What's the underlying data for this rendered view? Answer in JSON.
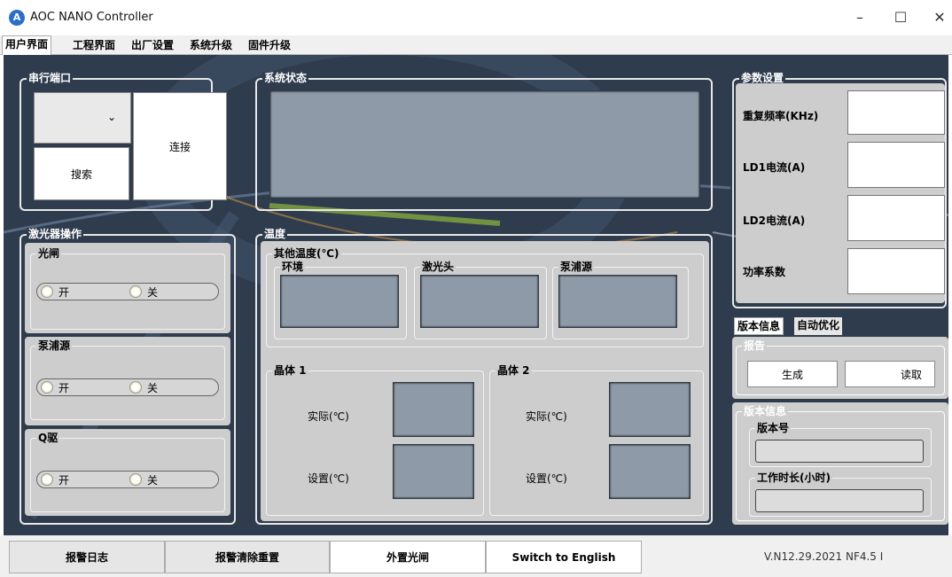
{
  "window": {
    "title": "AOC NANO Controller",
    "minimize": "–",
    "maximize": "☐",
    "close": "✕"
  },
  "tabs": [
    "用户界面",
    "工程界面",
    "出厂设置",
    "系统升级",
    "固件升级"
  ],
  "serial": {
    "title": "串行端口",
    "dropdown_arrow": "⌄",
    "search": "搜索",
    "connect": "连接"
  },
  "status": {
    "title": "系统状态"
  },
  "params": {
    "title": "参数设置",
    "rows": [
      "重复频率(KHz)",
      "LD1电流(A)",
      "LD2电流(A)",
      "功率系数"
    ]
  },
  "laser": {
    "title": "激光器操作",
    "groups": [
      {
        "name": "光闸",
        "on": "开",
        "off": "关"
      },
      {
        "name": "泵浦源",
        "on": "开",
        "off": "关"
      },
      {
        "name": "Q驱",
        "on": "开",
        "off": "关"
      }
    ]
  },
  "temperature": {
    "title": "温度",
    "other": {
      "title": "其他温度(℃)",
      "items": [
        "环境",
        "激光头",
        "泵浦源"
      ]
    },
    "crystal1": {
      "title": "晶体 1",
      "actual": "实际(℃)",
      "setting": "设置(℃)"
    },
    "crystal2": {
      "title": "晶体 2",
      "actual": "实际(℃)",
      "setting": "设置(℃)"
    }
  },
  "side_tabs": [
    "版本信息",
    "自动优化"
  ],
  "report": {
    "title": "报告",
    "generate": "生成",
    "read": "读取"
  },
  "version_info": {
    "title": "版本信息",
    "version_label": "版本号",
    "hours_label": "工作时长(小时)"
  },
  "bottom": {
    "alarm_log": "报警日志",
    "alarm_reset": "报警清除重置",
    "external_shutter": "外置光闸",
    "switch_lang": "Switch to English",
    "version": "V.N12.29.2021 NF4.5 I"
  },
  "colors": {
    "panel_bg": "#2f3c4e",
    "display": "#8e9aa7",
    "group_bg": "#cdcdcd"
  }
}
